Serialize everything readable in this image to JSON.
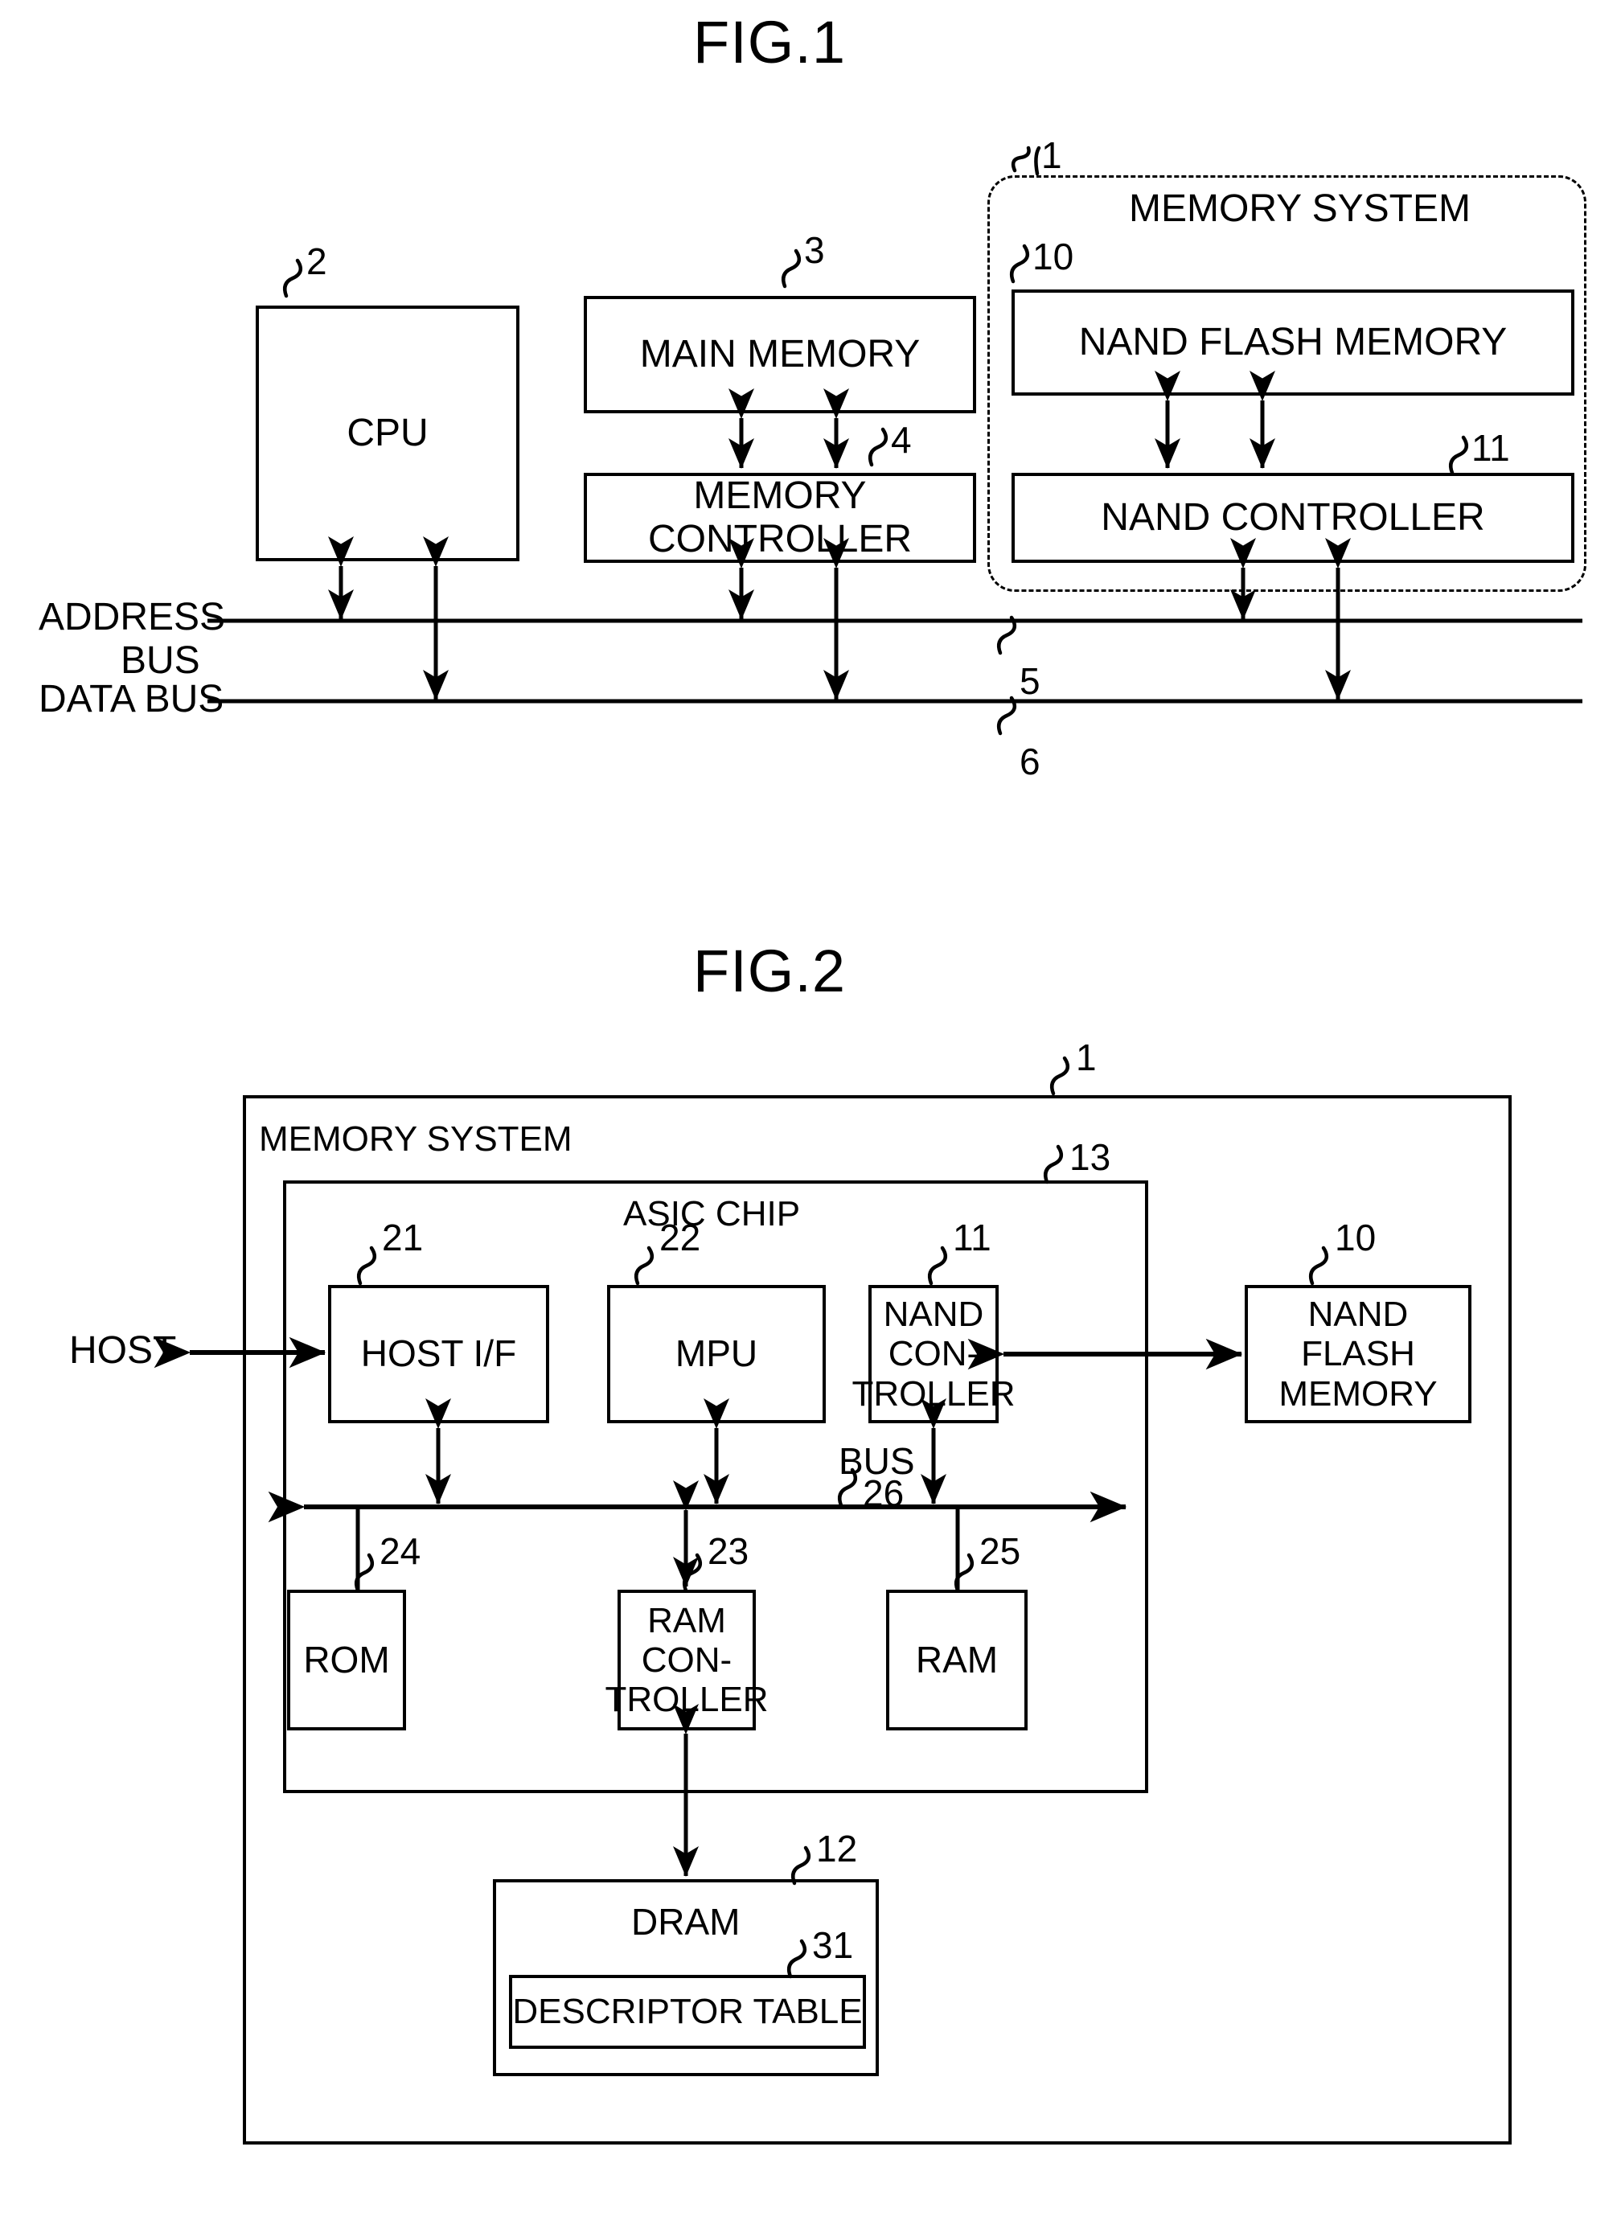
{
  "figures": [
    {
      "title": "FIG.1",
      "ref_labels": {
        "system": "1",
        "cpu": "2",
        "main_memory": "3",
        "memory_controller": "4",
        "address_bus": "5",
        "data_bus": "6",
        "nand_flash": "10",
        "nand_controller": "11"
      },
      "blocks": {
        "cpu": "CPU",
        "main_memory": "MAIN MEMORY",
        "memory_controller_line1": "MEMORY",
        "memory_controller_line2": "CONTROLLER",
        "memory_system": "MEMORY SYSTEM",
        "nand_flash_memory": "NAND FLASH MEMORY",
        "nand_controller": "NAND CONTROLLER"
      },
      "bus_labels": {
        "address_line1": "ADDRESS",
        "address_line2": "BUS",
        "data": "DATA BUS"
      }
    },
    {
      "title": "FIG.2",
      "ref_labels": {
        "memory_system": "1",
        "nand_flash": "10",
        "nand_controller": "11",
        "dram": "12",
        "asic_chip": "13",
        "host_if": "21",
        "mpu": "22",
        "ram_controller": "23",
        "rom": "24",
        "ram": "25",
        "bus": "26",
        "descriptor_table": "31"
      },
      "blocks": {
        "memory_system": "MEMORY SYSTEM",
        "asic_chip": "ASIC CHIP",
        "host": "HOST",
        "host_if": "HOST I/F",
        "mpu": "MPU",
        "nand_controller_line1": "NAND",
        "nand_controller_line2": "CON-",
        "nand_controller_line3": "TROLLER",
        "nand_flash_line1": "NAND FLASH",
        "nand_flash_line2": "MEMORY",
        "rom": "ROM",
        "ram_controller_line1": "RAM",
        "ram_controller_line2": "CON-",
        "ram_controller_line3": "TROLLER",
        "ram": "RAM",
        "bus": "BUS",
        "dram": "DRAM",
        "descriptor_table": "DESCRIPTOR TABLE"
      }
    }
  ]
}
